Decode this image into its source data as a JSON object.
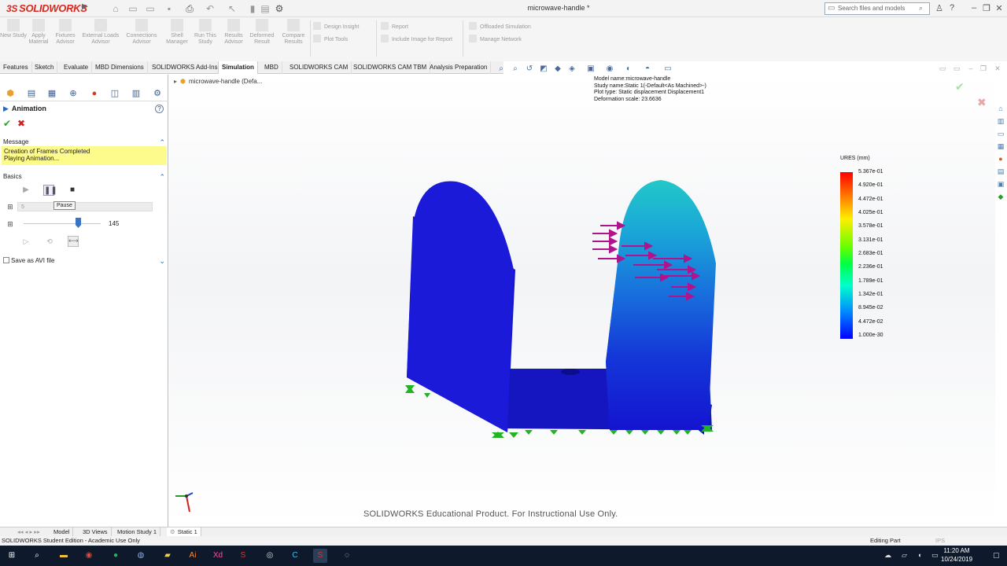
{
  "app": {
    "logo_text": "SOLIDWORKS",
    "document_title": "microwave-handle *",
    "search_placeholder": "Search files and models"
  },
  "command_manager": {
    "large_buttons": [
      "New Study",
      "Apply Material",
      "Fixtures Advisor",
      "External Loads Advisor",
      "Connections Advisor",
      "Shell Manager",
      "Run This Study",
      "Results Advisor",
      "Deformed Result",
      "Compare Results"
    ],
    "small_buttons": [
      "Design Insight",
      "Plot Tools",
      "Report",
      "Include Image for Report",
      "Offloaded Simulation",
      "Manage Network"
    ]
  },
  "tabs": [
    "Features",
    "Sketch",
    "Evaluate",
    "MBD Dimensions",
    "SOLIDWORKS Add-Ins",
    "Simulation",
    "MBD",
    "SOLIDWORKS CAM",
    "SOLIDWORKS CAM TBM",
    "Analysis Preparation"
  ],
  "active_tab": "Simulation",
  "property_manager": {
    "title": "Animation",
    "help": "?",
    "message_header": "Message",
    "message_lines": [
      "Creation of Frames Completed",
      "Playing Animation..."
    ],
    "basics_header": "Basics",
    "tooltip": "Pause",
    "frames_value": "5",
    "speed_value": "145",
    "save_avi_label": "Save as AVI file"
  },
  "viewport": {
    "tree_flyout": "microwave-handle  (Defa...",
    "study_info": [
      "Model name:microwave-handle",
      "Study name:Static 1(-Default<As Machined>-)",
      "Plot type: Static displacement Displacement1",
      "Deformation scale: 23.6636"
    ],
    "legend_title": "URES (mm)",
    "legend_ticks": [
      "5.367e-01",
      "4.920e-01",
      "4.472e-01",
      "4.025e-01",
      "3.578e-01",
      "3.131e-01",
      "2.683e-01",
      "2.236e-01",
      "1.789e-01",
      "1.342e-01",
      "8.945e-02",
      "4.472e-02",
      "1.000e-30"
    ],
    "watermark": "SOLIDWORKS Educational Product. For Instructional Use Only."
  },
  "bottom_tabs": [
    "Model",
    "3D Views",
    "Motion Study 1",
    "Static 1"
  ],
  "active_bottom_tab": "Static 1",
  "status_bar": {
    "left": "SOLIDWORKS Student Edition - Academic Use Only",
    "mode": "Editing Part",
    "units": "IPS"
  },
  "taskbar": {
    "time": "11:20 AM",
    "date": "10/24/2019"
  },
  "colors": {
    "accent": "#2a6ab8",
    "message_bg": "#fdfb8c",
    "model_blue": "#1414d8",
    "load_arrows": "#b0148c",
    "fixtures": "#22b422"
  }
}
